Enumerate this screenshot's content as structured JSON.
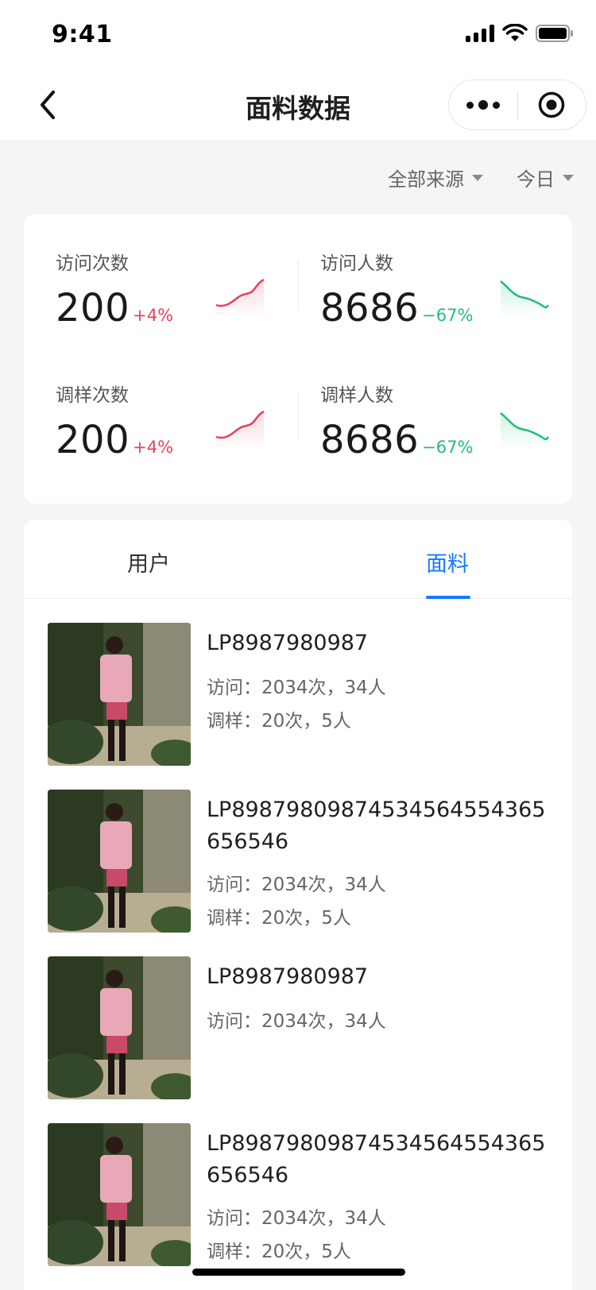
{
  "status_bar": {
    "time": "9:41"
  },
  "nav": {
    "title": "面料数据"
  },
  "filters": {
    "source": "全部来源",
    "period": "今日"
  },
  "stats": [
    {
      "label": "访问次数",
      "value": "200",
      "delta": "+4%",
      "trend": "up"
    },
    {
      "label": "访问人数",
      "value": "8686",
      "delta": "−67%",
      "trend": "down"
    },
    {
      "label": "调样次数",
      "value": "200",
      "delta": "+4%",
      "trend": "up"
    },
    {
      "label": "调样人数",
      "value": "8686",
      "delta": "−67%",
      "trend": "down"
    }
  ],
  "tabs": {
    "user": "用户",
    "fabric": "面料",
    "active": "fabric"
  },
  "items": [
    {
      "code": "LP8987980987",
      "visits": "访问：2034次，34人",
      "samples": "调样：20次，5人"
    },
    {
      "code": "LP89879809874534564554365656546",
      "visits": "访问：2034次，34人",
      "samples": "调样：20次，5人"
    },
    {
      "code": "LP8987980987",
      "visits": "访问：2034次，34人"
    },
    {
      "code": "LP89879809874534564554365656546",
      "visits": "访问：2034次，34人",
      "samples": "调样：20次，5人"
    }
  ],
  "colors": {
    "accent": "#1778ff",
    "up": "#e8405c",
    "down": "#1ebf76"
  }
}
